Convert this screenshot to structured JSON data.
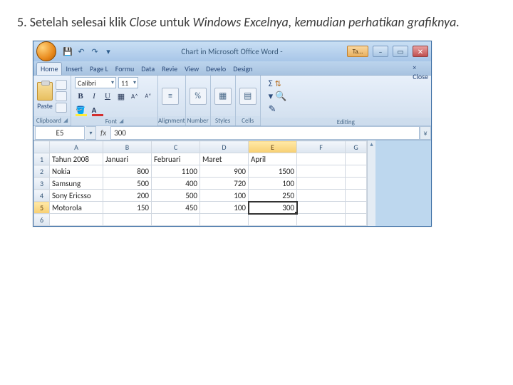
{
  "instruction": {
    "prefix": "5. Setelah selesai klik ",
    "close_word": "Close",
    "mid": " untuk ",
    "italic_tail": "Windows Excelnya, kemudian perhatikan grafiknya.",
    "period": ""
  },
  "titlebar": {
    "title": "Chart in Microsoft Office Word -",
    "ta_label": "Ta...",
    "minimize": "–",
    "maximize": "▭",
    "close": "✕",
    "qat_save": "💾",
    "qat_undo": "↶",
    "qat_redo": "↷",
    "qat_more": "▾"
  },
  "tabs": {
    "items": [
      "Home",
      "Insert",
      "Page L",
      "Formu",
      "Data",
      "Revie",
      "View",
      "Develo",
      "Design"
    ],
    "active_index": 0,
    "close_label": "Close",
    "close_x": "×"
  },
  "ribbon": {
    "clipboard": {
      "paste": "Paste",
      "label": "Clipboard"
    },
    "font": {
      "name": "Calibri",
      "size": "11",
      "b": "B",
      "i": "I",
      "u": "U",
      "aplus": "A˄",
      "aminus": "A˅",
      "label": "Font"
    },
    "alignment": {
      "icon": "≡",
      "label": "Alignment"
    },
    "number": {
      "icon": "%",
      "label": "Number"
    },
    "styles": {
      "label": "Styles"
    },
    "cells": {
      "label": "Cells"
    },
    "editing": {
      "sigma": "Σ",
      "sort": "A↓Z",
      "find": "🔍",
      "label": "Editing"
    }
  },
  "formula_bar": {
    "name_box": "E5",
    "fx": "fx",
    "value": "300",
    "expand": "¥"
  },
  "chart_data": {
    "type": "table",
    "columns": [
      "A",
      "B",
      "C",
      "D",
      "E",
      "F",
      "G"
    ],
    "header_row_label": "Tahun 2008",
    "months": [
      "Januari",
      "Februari",
      "Maret",
      "April"
    ],
    "rows": [
      {
        "label": "Nokia",
        "values": [
          800,
          1100,
          900,
          1500
        ]
      },
      {
        "label": "Samsung",
        "values": [
          500,
          400,
          720,
          100
        ]
      },
      {
        "label": "Sony Ericsso",
        "values": [
          200,
          500,
          100,
          250
        ]
      },
      {
        "label": "Motorola",
        "values": [
          150,
          450,
          100,
          300
        ]
      }
    ],
    "selected_cell": "E5",
    "selected_value": 300
  }
}
